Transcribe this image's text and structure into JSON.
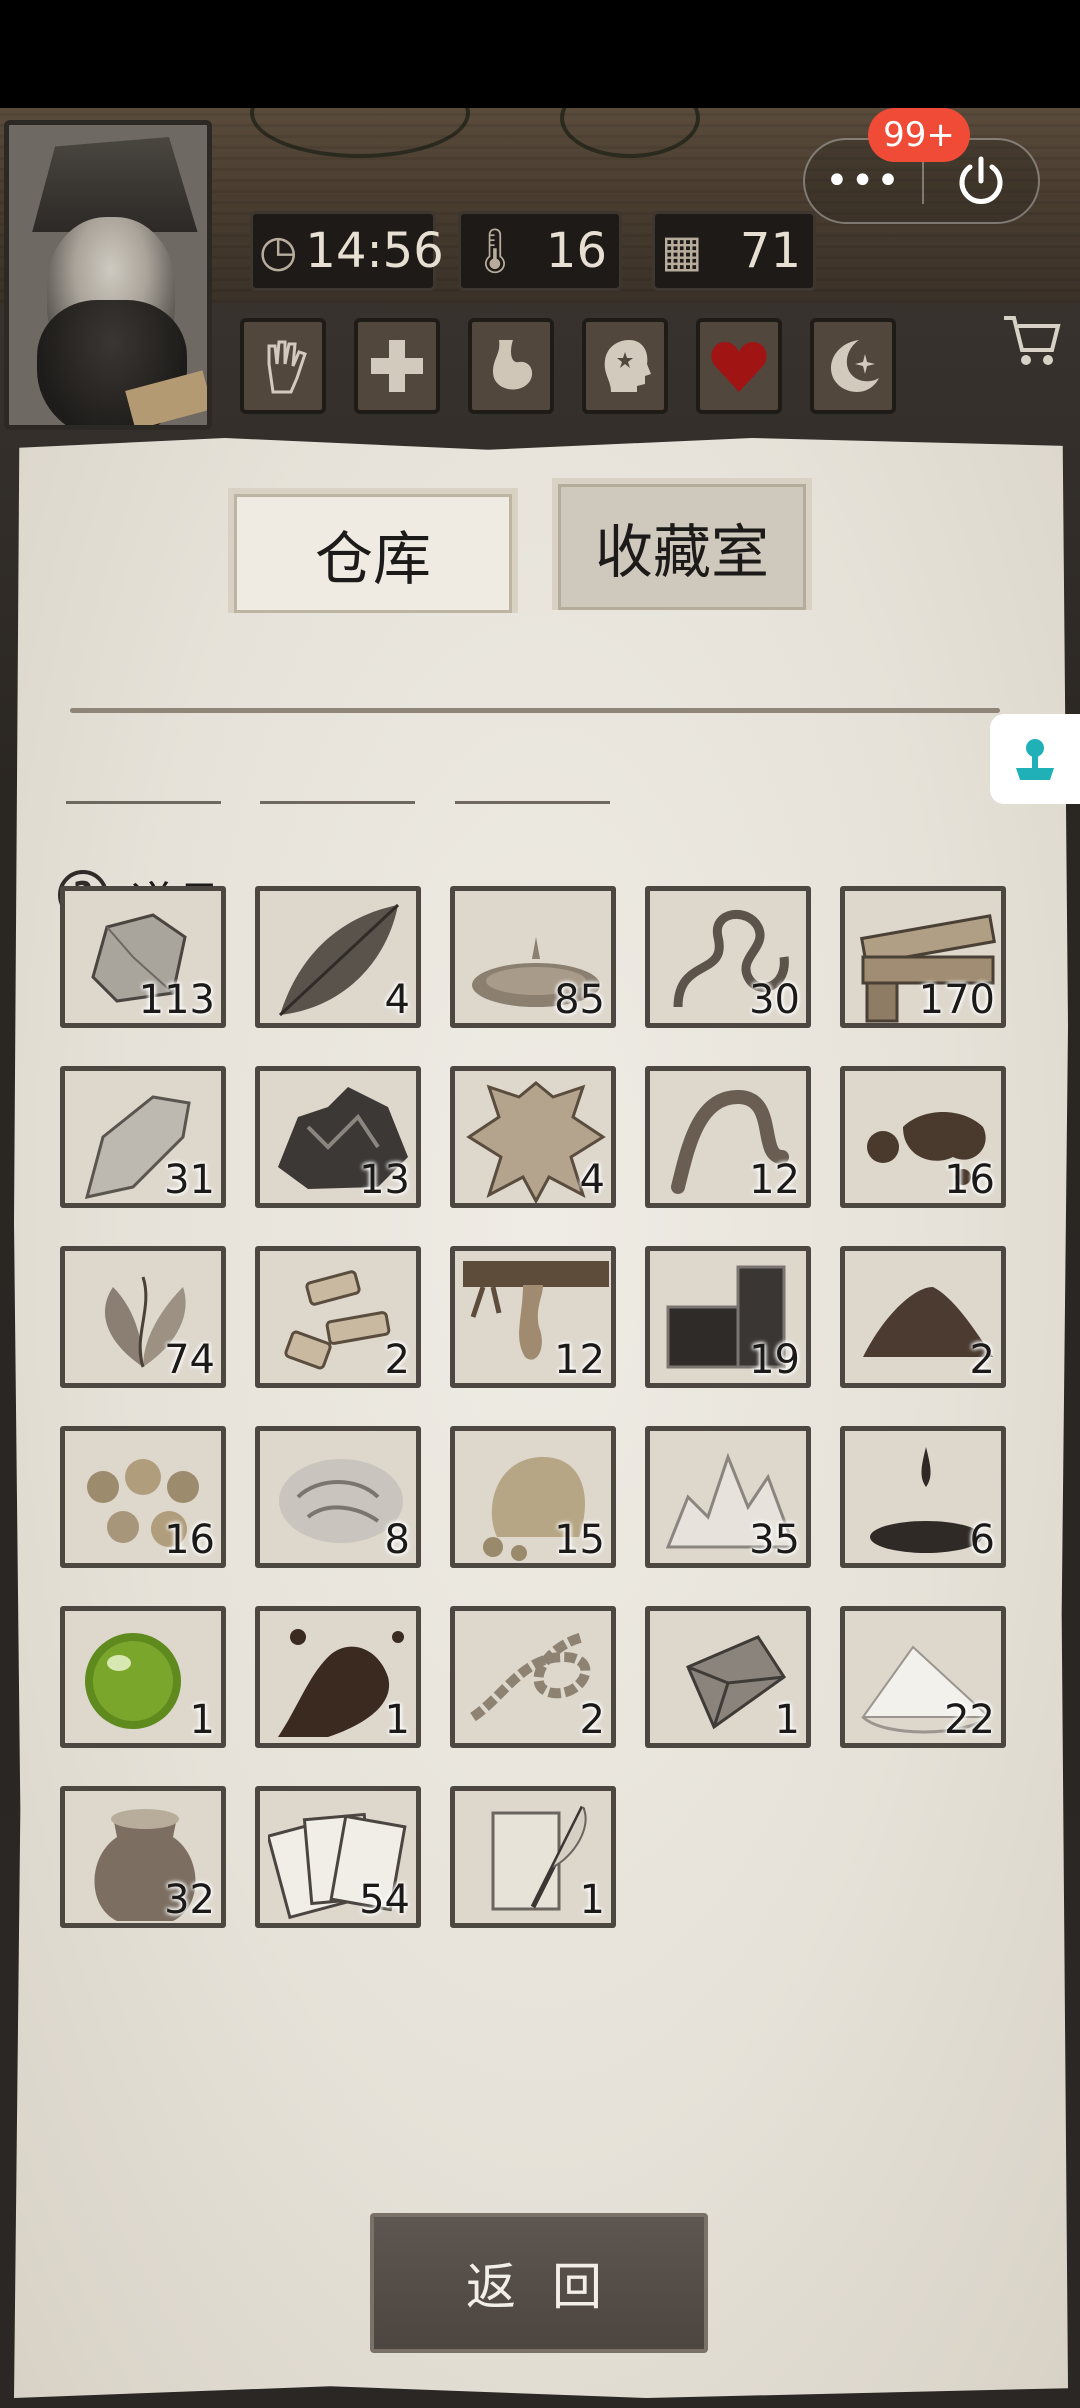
{
  "header": {
    "time": "14:56",
    "temperature": "16",
    "day": "71",
    "conditions": [
      {
        "name": "hand-icon"
      },
      {
        "name": "health-cross-icon"
      },
      {
        "name": "stomach-icon"
      },
      {
        "name": "mind-icon"
      },
      {
        "name": "heart-icon"
      },
      {
        "name": "moon-icon"
      }
    ]
  },
  "miniprogram": {
    "more": "•••",
    "badge": "99+"
  },
  "tabs": {
    "warehouse": "仓库",
    "collection": "收藏室"
  },
  "section": {
    "title": "道具",
    "help": "?"
  },
  "items": [
    {
      "name": "stone",
      "count": "113"
    },
    {
      "name": "leaf",
      "count": "4"
    },
    {
      "name": "water",
      "count": "85"
    },
    {
      "name": "vine",
      "count": "30"
    },
    {
      "name": "wood-planks",
      "count": "170"
    },
    {
      "name": "flint",
      "count": "31"
    },
    {
      "name": "iron-ore",
      "count": "13"
    },
    {
      "name": "animal-hide",
      "count": "4"
    },
    {
      "name": "worm",
      "count": "12"
    },
    {
      "name": "mud",
      "count": "16"
    },
    {
      "name": "herb",
      "count": "74"
    },
    {
      "name": "bone-pieces",
      "count": "2"
    },
    {
      "name": "resin",
      "count": "12"
    },
    {
      "name": "coal",
      "count": "19"
    },
    {
      "name": "soil",
      "count": "2"
    },
    {
      "name": "gold-nuggets",
      "count": "16"
    },
    {
      "name": "wool",
      "count": "8"
    },
    {
      "name": "clay-lump",
      "count": "15"
    },
    {
      "name": "salt-crystals",
      "count": "35"
    },
    {
      "name": "oil",
      "count": "6"
    },
    {
      "name": "green-orb",
      "count": "1"
    },
    {
      "name": "dark-splash",
      "count": "1"
    },
    {
      "name": "rope",
      "count": "2"
    },
    {
      "name": "metal-pyramid",
      "count": "1"
    },
    {
      "name": "flour-pile",
      "count": "22"
    },
    {
      "name": "grain-sack",
      "count": "32"
    },
    {
      "name": "playing-cards",
      "count": "54"
    },
    {
      "name": "scroll-quill",
      "count": "1"
    }
  ],
  "buttons": {
    "back": "返 回"
  }
}
